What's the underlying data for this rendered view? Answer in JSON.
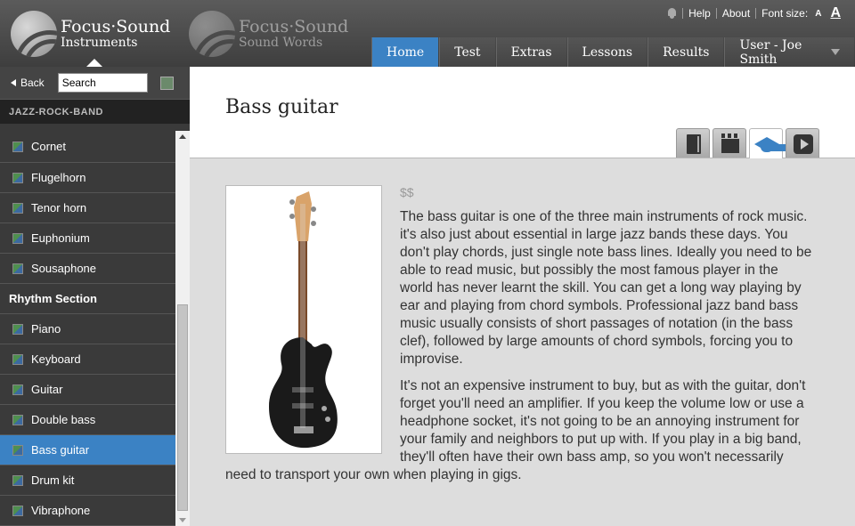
{
  "header": {
    "logo1": {
      "line1": "Focus·Sound",
      "line2": "Instruments"
    },
    "logo2": {
      "line1": "Focus·Sound",
      "line2": "Sound Words"
    },
    "links": {
      "help": "Help",
      "about": "About",
      "font_size_label": "Font size:",
      "font_small": "A",
      "font_large": "A"
    },
    "nav": [
      {
        "label": "Home"
      },
      {
        "label": "Test"
      },
      {
        "label": "Extras"
      },
      {
        "label": "Lessons"
      },
      {
        "label": "Results"
      },
      {
        "label": "User - Joe Smith"
      }
    ]
  },
  "sidebar": {
    "back_label": "Back",
    "search_value": "Search",
    "section": "JAZZ-ROCK-BAND",
    "items": [
      {
        "label": "Cornet"
      },
      {
        "label": "Flugelhorn"
      },
      {
        "label": "Tenor horn"
      },
      {
        "label": "Euphonium"
      },
      {
        "label": "Sousaphone"
      },
      {
        "label": "Rhythm Section"
      },
      {
        "label": "Piano"
      },
      {
        "label": "Keyboard"
      },
      {
        "label": "Guitar"
      },
      {
        "label": "Double bass"
      },
      {
        "label": "Bass guitar"
      },
      {
        "label": "Drum kit"
      },
      {
        "label": "Vibraphone"
      }
    ]
  },
  "main": {
    "title": "Bass guitar",
    "price": "$$",
    "paragraphs": [
      "The bass guitar is one of the three main instruments of rock music. it's also just about essential in large jazz bands these days. You don't play chords, just single note bass lines. Ideally you need to be able to read music, but possibly the most famous player in the world has never learnt the skill. You can get a long way playing by ear and playing from chord symbols. Professional jazz band bass music usually consists of short passages of notation (in the bass clef), followed by large amounts of chord symbols, forcing you to improvise.",
      "It's not an expensive instrument to buy, but as with the guitar, don't forget you'll need an amplifier. If you keep the volume low or use a headphone socket, it's not going to be an annoying instrument for your family and neighbors to put up with. If you play in a big band, they'll often have their own bass amp, so you won't necessarily need to transport your own when playing in gigs."
    ]
  },
  "colors": {
    "accent": "#3b82c4",
    "header": "#4a4a4a",
    "sidebar": "#3a3a3a"
  }
}
